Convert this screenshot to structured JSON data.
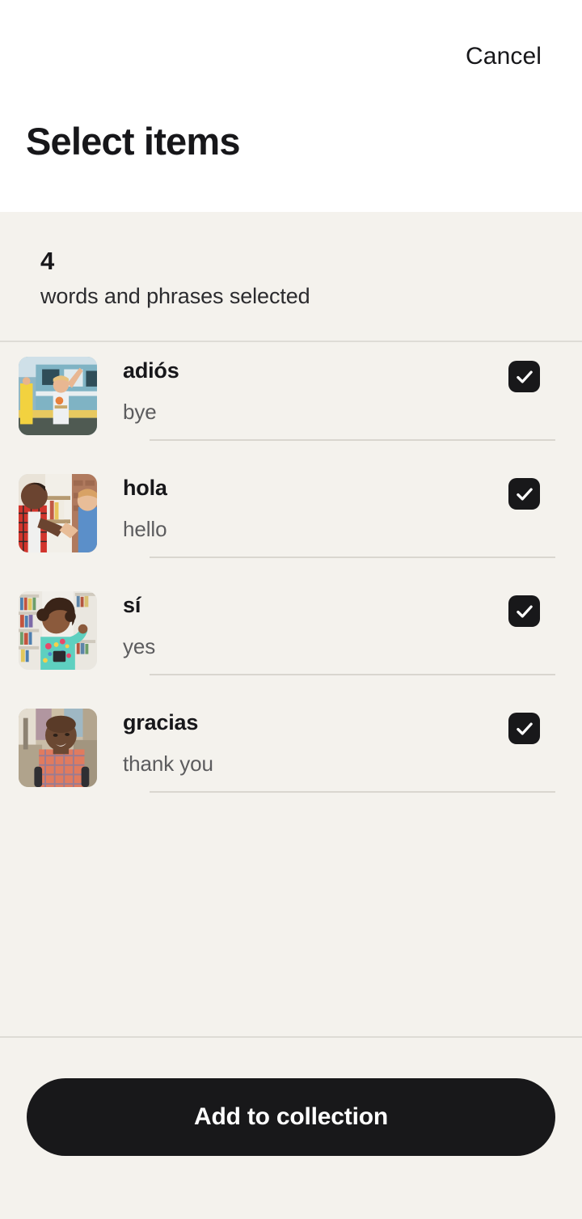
{
  "header": {
    "cancel_label": "Cancel",
    "title": "Select items"
  },
  "summary": {
    "count": "4",
    "label": "words and phrases selected"
  },
  "list": {
    "items": [
      {
        "term": "adiós",
        "translation": "bye",
        "checked": true,
        "image_alt": "woman-waving-at-train-station"
      },
      {
        "term": "hola",
        "translation": "hello",
        "checked": true,
        "image_alt": "two-men-shaking-hands"
      },
      {
        "term": "sí",
        "translation": "yes",
        "checked": true,
        "image_alt": "woman-celebrating-with-phone-by-bookshelf"
      },
      {
        "term": "gracias",
        "translation": "thank you",
        "checked": true,
        "image_alt": "smiling-older-man-in-plaid-shirt"
      }
    ]
  },
  "footer": {
    "primary_label": "Add to collection"
  },
  "colors": {
    "background": "#f4f2ed",
    "header_background": "#ffffff",
    "text_primary": "#17171a",
    "text_secondary": "#5c5c5e",
    "accent_dark": "#18181a",
    "divider": "#d9d6cf"
  }
}
